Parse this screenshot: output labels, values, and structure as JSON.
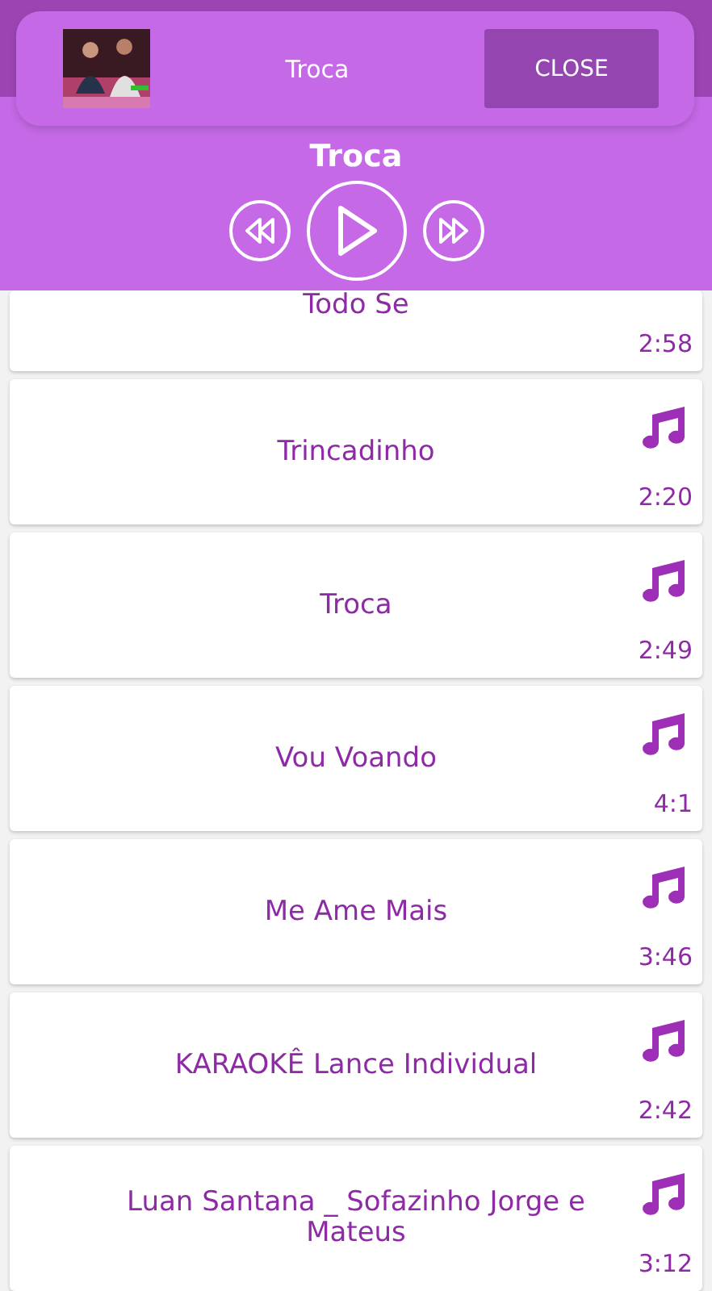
{
  "notification": {
    "title": "Troca",
    "button": "CLOSE"
  },
  "player": {
    "title": "Troca",
    "playing": false
  },
  "songs": [
    {
      "title": "Todo Se",
      "duration": "2:58"
    },
    {
      "title": "Trincadinho",
      "duration": "2:20"
    },
    {
      "title": "Troca",
      "duration": "2:49"
    },
    {
      "title": "Vou Voando",
      "duration": "4:1"
    },
    {
      "title": "Me Ame Mais",
      "duration": "3:46"
    },
    {
      "title": "KARAOKÊ Lance Individual",
      "duration": "2:42"
    },
    {
      "title": "Luan Santana _ Sofazinho Jorge e Mateus",
      "duration": "3:12"
    }
  ]
}
